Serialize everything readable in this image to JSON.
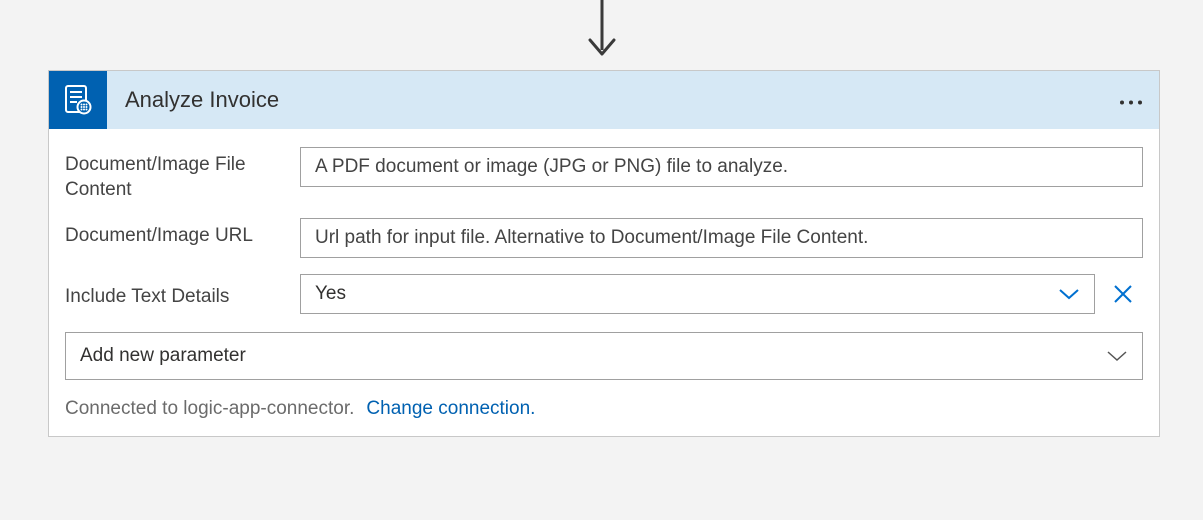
{
  "header": {
    "title": "Analyze Invoice"
  },
  "fields": {
    "file_content": {
      "label": "Document/Image File Content",
      "placeholder": "A PDF document or image (JPG or PNG) file to analyze."
    },
    "url": {
      "label": "Document/Image URL",
      "placeholder": "Url path for input file. Alternative to Document/Image File Content."
    },
    "include_text_details": {
      "label": "Include Text Details",
      "value": "Yes"
    }
  },
  "add_parameter": {
    "label": "Add new parameter"
  },
  "footer": {
    "connected_text": "Connected to logic-app-connector.",
    "change_link": "Change connection."
  }
}
